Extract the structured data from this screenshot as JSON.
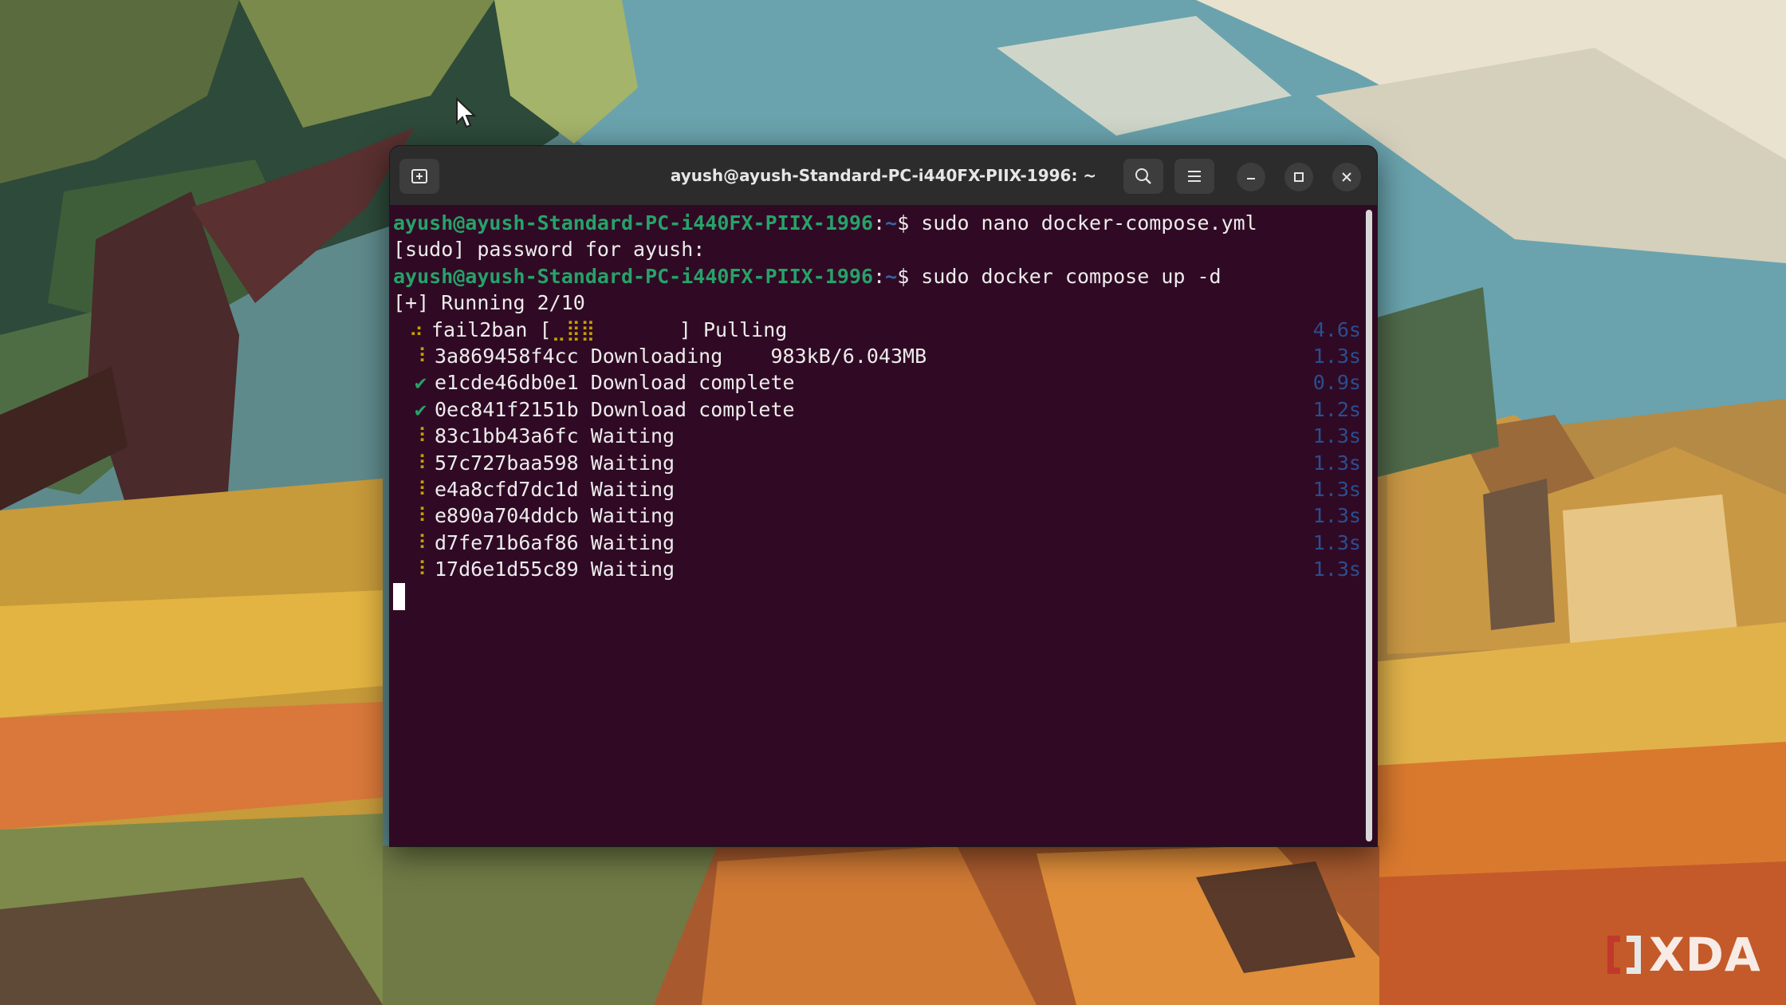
{
  "window": {
    "title": "ayush@ayush-Standard-PC-i440FX-PIIX-1996: ~"
  },
  "watermark": {
    "text": "XDA"
  },
  "terminal": {
    "prompt_user": "ayush@ayush-Standard-PC-i440FX-PIIX-1996",
    "prompt_sep": ":",
    "prompt_path": "~",
    "prompt_symbol": "$ ",
    "cmd1": "sudo nano docker-compose.yml",
    "sudo_line": "[sudo] password for ayush:",
    "cmd2": "sudo docker compose up -d",
    "running": "[+] Running 2/10",
    "service": {
      "spinner": "⠴",
      "name": "fail2ban",
      "bar_open": "[",
      "bar_glyph": "⣀⣿⣿",
      "bar_close": "]",
      "status": "Pulling",
      "time": "4.6s"
    },
    "layers": [
      {
        "icon": "⠸",
        "id": "3a869458f4cc",
        "status": "Downloading",
        "detail": "983kB/6.043MB",
        "time": "1.3s"
      },
      {
        "icon": "✔",
        "id": "e1cde46db0e1",
        "status": "Download complete",
        "detail": "",
        "time": "0.9s"
      },
      {
        "icon": "✔",
        "id": "0ec841f2151b",
        "status": "Download complete",
        "detail": "",
        "time": "1.2s"
      },
      {
        "icon": "⠸",
        "id": "83c1bb43a6fc",
        "status": "Waiting",
        "detail": "",
        "time": "1.3s"
      },
      {
        "icon": "⠸",
        "id": "57c727baa598",
        "status": "Waiting",
        "detail": "",
        "time": "1.3s"
      },
      {
        "icon": "⠸",
        "id": "e4a8cfd7dc1d",
        "status": "Waiting",
        "detail": "",
        "time": "1.3s"
      },
      {
        "icon": "⠸",
        "id": "e890a704ddcb",
        "status": "Waiting",
        "detail": "",
        "time": "1.3s"
      },
      {
        "icon": "⠸",
        "id": "d7fe71b6af86",
        "status": "Waiting",
        "detail": "",
        "time": "1.3s"
      },
      {
        "icon": "⠸",
        "id": "17d6e1d55c89",
        "status": "Waiting",
        "detail": "",
        "time": "1.3s"
      }
    ]
  },
  "colors": {
    "terminal_bg": "#300a24",
    "prompt_user": "#26a269",
    "prompt_path": "#3465a4",
    "time_text": "#2a4e90"
  },
  "icons": [
    "new-tab-icon",
    "search-icon",
    "hamburger-menu-icon",
    "minimize-icon",
    "maximize-icon",
    "close-icon",
    "mouse-pointer-icon",
    "xda-logo-icon"
  ]
}
